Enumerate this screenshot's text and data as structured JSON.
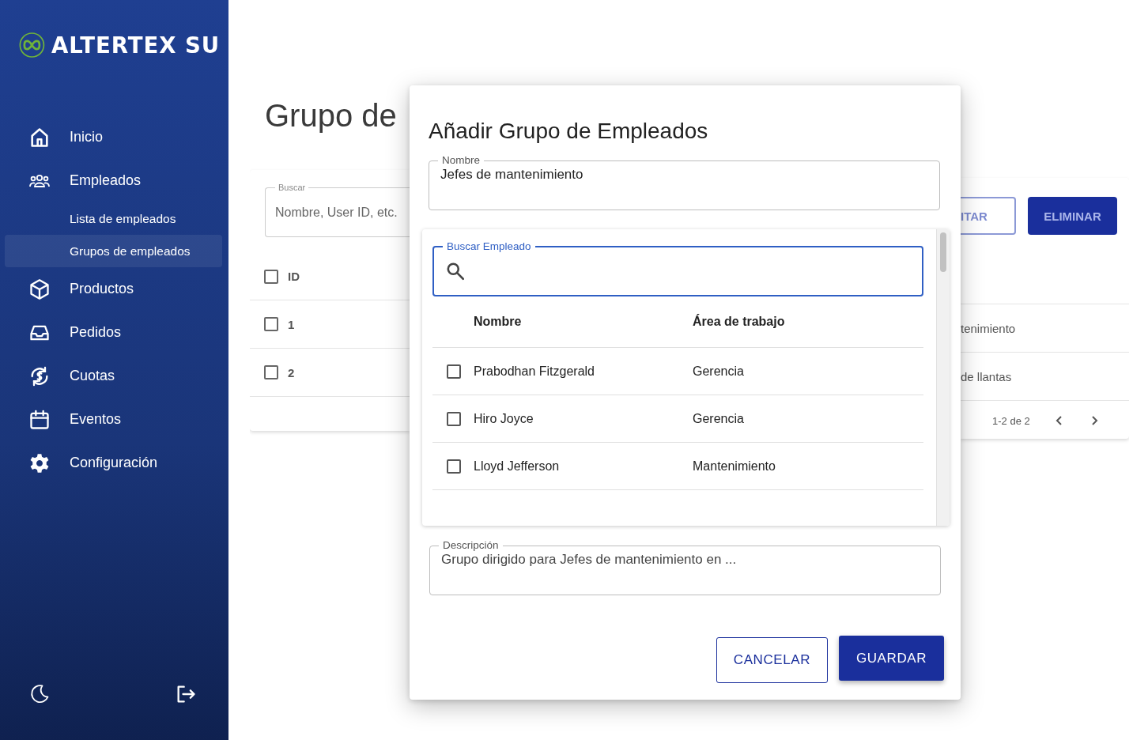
{
  "sidebar": {
    "logo": "ALTERTEX SU",
    "items": [
      {
        "label": "Inicio",
        "kind": "home",
        "selected": false
      },
      {
        "label": "Empleados",
        "kind": "people",
        "selected": false,
        "children": [
          {
            "label": "Lista de empleados",
            "selected": false
          },
          {
            "label": "Grupos de empleados",
            "selected": true
          }
        ]
      },
      {
        "label": "Productos",
        "kind": "box",
        "selected": false
      },
      {
        "label": "Pedidos",
        "kind": "inbox",
        "selected": false
      },
      {
        "label": "Cuotas",
        "kind": "money",
        "selected": false
      },
      {
        "label": "Eventos",
        "kind": "calendar",
        "selected": false
      },
      {
        "label": "Configuración",
        "kind": "gear",
        "selected": false
      }
    ]
  },
  "page": {
    "title": "Grupo de",
    "search": {
      "label": "Buscar",
      "placeholder": "Nombre, User ID, etc."
    },
    "table_left": {
      "header": {
        "label": "ID",
        "checked": false
      },
      "rows": [
        {
          "label": "1",
          "checked": false
        },
        {
          "label": "2",
          "checked": false
        }
      ]
    },
    "buttons": [
      {
        "label": "ITAR",
        "kind": "outlined"
      },
      {
        "label": "ELIMINAR",
        "kind": "filled"
      }
    ],
    "table_right": [
      "tenimiento",
      "de llantas"
    ],
    "pagination": "1-2 de 2"
  },
  "dialog": {
    "title": "Añadir Grupo de Empleados",
    "name_field": {
      "label": "Nombre",
      "value": "Jefes de mantenimiento"
    },
    "search_field": {
      "label": "Buscar Empleado"
    },
    "columns": [
      "Nombre",
      "Área de trabajo"
    ],
    "rows": [
      {
        "name": "Prabodhan Fitzgerald",
        "area": "Gerencia",
        "checked": false
      },
      {
        "name": "Hiro Joyce",
        "area": "Gerencia",
        "checked": false
      },
      {
        "name": "Lloyd Jefferson",
        "area": "Mantenimiento",
        "checked": false
      }
    ],
    "description_field": {
      "label": "Descripción",
      "value": "Grupo dirigido para Jefes de mantenimiento en ..."
    },
    "buttons": [
      {
        "label": "CANCELAR",
        "kind": "outlined"
      },
      {
        "label": "GUARDAR",
        "kind": "filled"
      }
    ]
  }
}
